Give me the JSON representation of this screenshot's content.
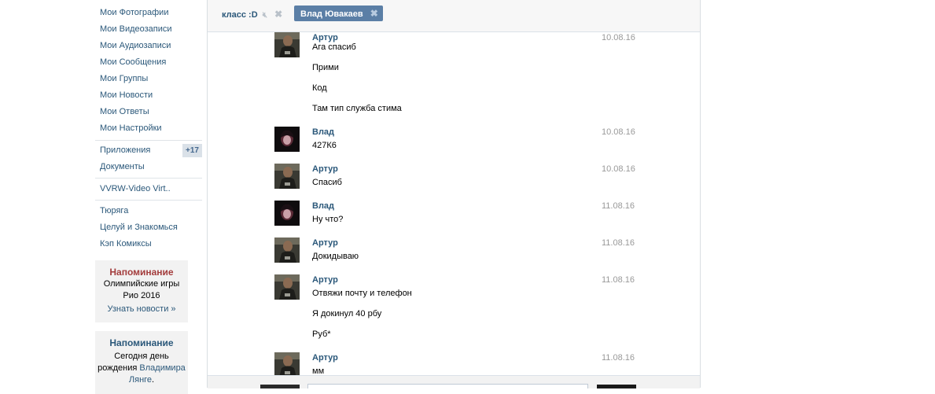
{
  "menu": {
    "items": [
      {
        "label": "Мои Фотографии"
      },
      {
        "label": "Мои Видеозаписи"
      },
      {
        "label": "Мои Аудиозаписи"
      },
      {
        "label": "Мои Сообщения"
      },
      {
        "label": "Мои Группы"
      },
      {
        "label": "Мои Новости"
      },
      {
        "label": "Мои Ответы"
      },
      {
        "label": "Мои Настройки"
      },
      {
        "label": "Приложения",
        "counter": "+17"
      },
      {
        "label": "Документы"
      },
      {
        "label": "VVRW-Video Virt.."
      },
      {
        "label": "Тюряга"
      },
      {
        "label": "Целуй и Знакомься"
      },
      {
        "label": "Кэп Комиксы"
      }
    ]
  },
  "reminders": [
    {
      "title": "Напоминание",
      "title_color": "#a33c3c",
      "line1": "Олимпийские игры",
      "line2": "Рио 2016",
      "link": "Узнать новости »"
    },
    {
      "title": "Напоминание",
      "title_color": "#2b587a",
      "text1": "Сегодня",
      "text2": "день",
      "text3": "рождения",
      "name1": "Владимира",
      "name2": "Лянге",
      "dot": "."
    }
  ],
  "tabs": [
    {
      "label": "класс :D"
    },
    {
      "label": "Влад Ювакаев"
    }
  ],
  "messages": [
    {
      "author": "Артур",
      "date": "10.08.16",
      "avatar": "artur",
      "lines": [
        "Ага спасиб",
        "Прими",
        "Код",
        "Там тип служба стима"
      ]
    },
    {
      "author": "Влад",
      "date": "10.08.16",
      "avatar": "vlad",
      "lines": [
        "427К6"
      ]
    },
    {
      "author": "Артур",
      "date": "10.08.16",
      "avatar": "artur",
      "lines": [
        "Спасиб"
      ]
    },
    {
      "author": "Влад",
      "date": "11.08.16",
      "avatar": "vlad",
      "lines": [
        "Ну что?"
      ]
    },
    {
      "author": "Артур",
      "date": "11.08.16",
      "avatar": "artur",
      "lines": [
        "Докидываю"
      ]
    },
    {
      "author": "Артур",
      "date": "11.08.16",
      "avatar": "artur",
      "lines": [
        "Отвяжи почту и телефон",
        "Я докинул 40 рбу",
        "Руб*"
      ]
    },
    {
      "author": "Артур",
      "date": "11.08.16",
      "avatar": "artur",
      "lines": [
        "мм"
      ]
    }
  ],
  "icons": {
    "mute": "speaker-muted-icon",
    "close": "close-icon"
  },
  "colors": {
    "link": "#2b587a",
    "tab_active": "#5b7fa6"
  }
}
